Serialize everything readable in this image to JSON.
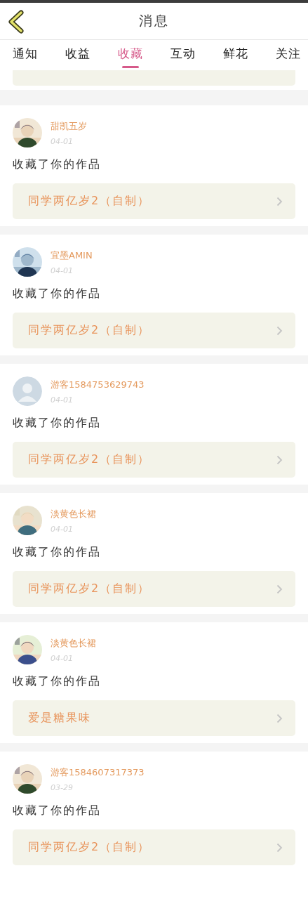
{
  "header": {
    "title": "消息"
  },
  "tabs": [
    {
      "label": "通知",
      "selected": false
    },
    {
      "label": "收益",
      "selected": false
    },
    {
      "label": "收藏",
      "selected": true
    },
    {
      "label": "互动",
      "selected": false
    },
    {
      "label": "鲜花",
      "selected": false
    },
    {
      "label": "关注",
      "selected": false
    }
  ],
  "messages": [
    {
      "user": "甜凯五岁",
      "date": "04-01",
      "action": "收藏了你的作品",
      "work": "同学两亿岁2（自制）"
    },
    {
      "user": "宜墨AMIN",
      "date": "04-01",
      "action": "收藏了你的作品",
      "work": "同学两亿岁2（自制）"
    },
    {
      "avatar": {
        "kind": "default"
      },
      "user": "游客1584753629743",
      "date": "04-01",
      "action": "收藏了你的作品",
      "work": "同学两亿岁2（自制）"
    },
    {
      "user": "淡黄色长裙",
      "date": "04-01",
      "action": "收藏了你的作品",
      "work": "同学两亿岁2（自制）"
    },
    {
      "user": "淡黄色长裙",
      "date": "04-01",
      "action": "收藏了你的作品",
      "work": "爱是糖果味"
    },
    {
      "user": "游客1584607317373",
      "date": "03-29",
      "action": "收藏了你的作品",
      "work": "同学两亿岁2（自制）"
    }
  ]
}
